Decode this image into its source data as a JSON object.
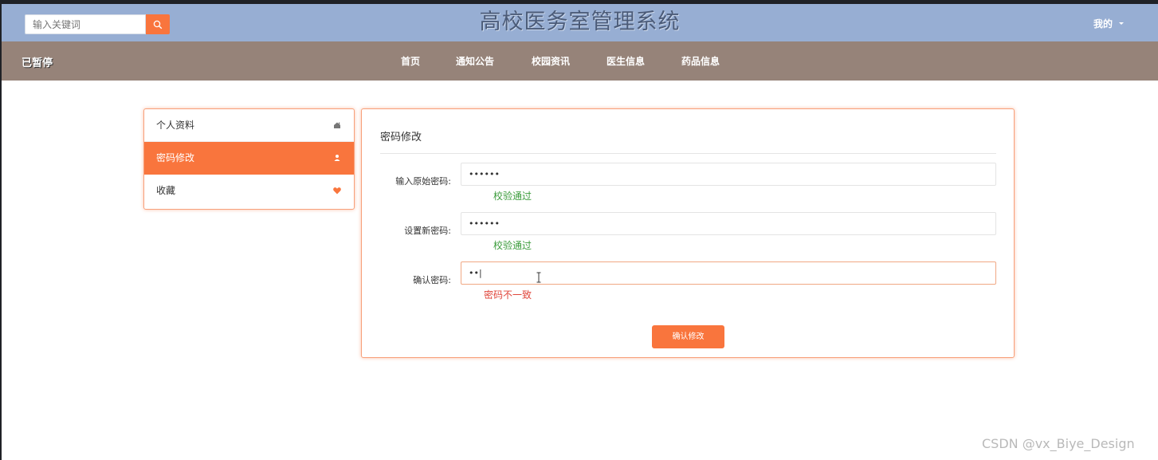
{
  "header": {
    "search_placeholder": "输入关键词",
    "site_title": "高校医务室管理系统",
    "user_menu_label": "我的"
  },
  "nav": {
    "status": "已暂停",
    "items": [
      "首页",
      "通知公告",
      "校园资讯",
      "医生信息",
      "药品信息"
    ]
  },
  "sidebar": {
    "items": [
      {
        "label": "个人资料",
        "icon": "home-icon"
      },
      {
        "label": "密码修改",
        "icon": "user-icon",
        "active": true
      },
      {
        "label": "收藏",
        "icon": "heart-icon"
      }
    ]
  },
  "form": {
    "title": "密码修改",
    "fields": [
      {
        "label": "输入原始密码:",
        "value": "••••••",
        "message": "校验通过",
        "status": "ok"
      },
      {
        "label": "设置新密码:",
        "value": "••••••",
        "message": "校验通过",
        "status": "ok"
      },
      {
        "label": "确认密码:",
        "value": "••|",
        "message": "密码不一致",
        "status": "error"
      }
    ],
    "submit_label": "确认修改"
  },
  "watermark": "CSDN @vx_Biye_Design",
  "colors": {
    "accent": "#f9753d",
    "header_bg": "#97aed3",
    "nav_bg": "#968379",
    "ok": "#3a9b3a",
    "error": "#e0453a"
  }
}
